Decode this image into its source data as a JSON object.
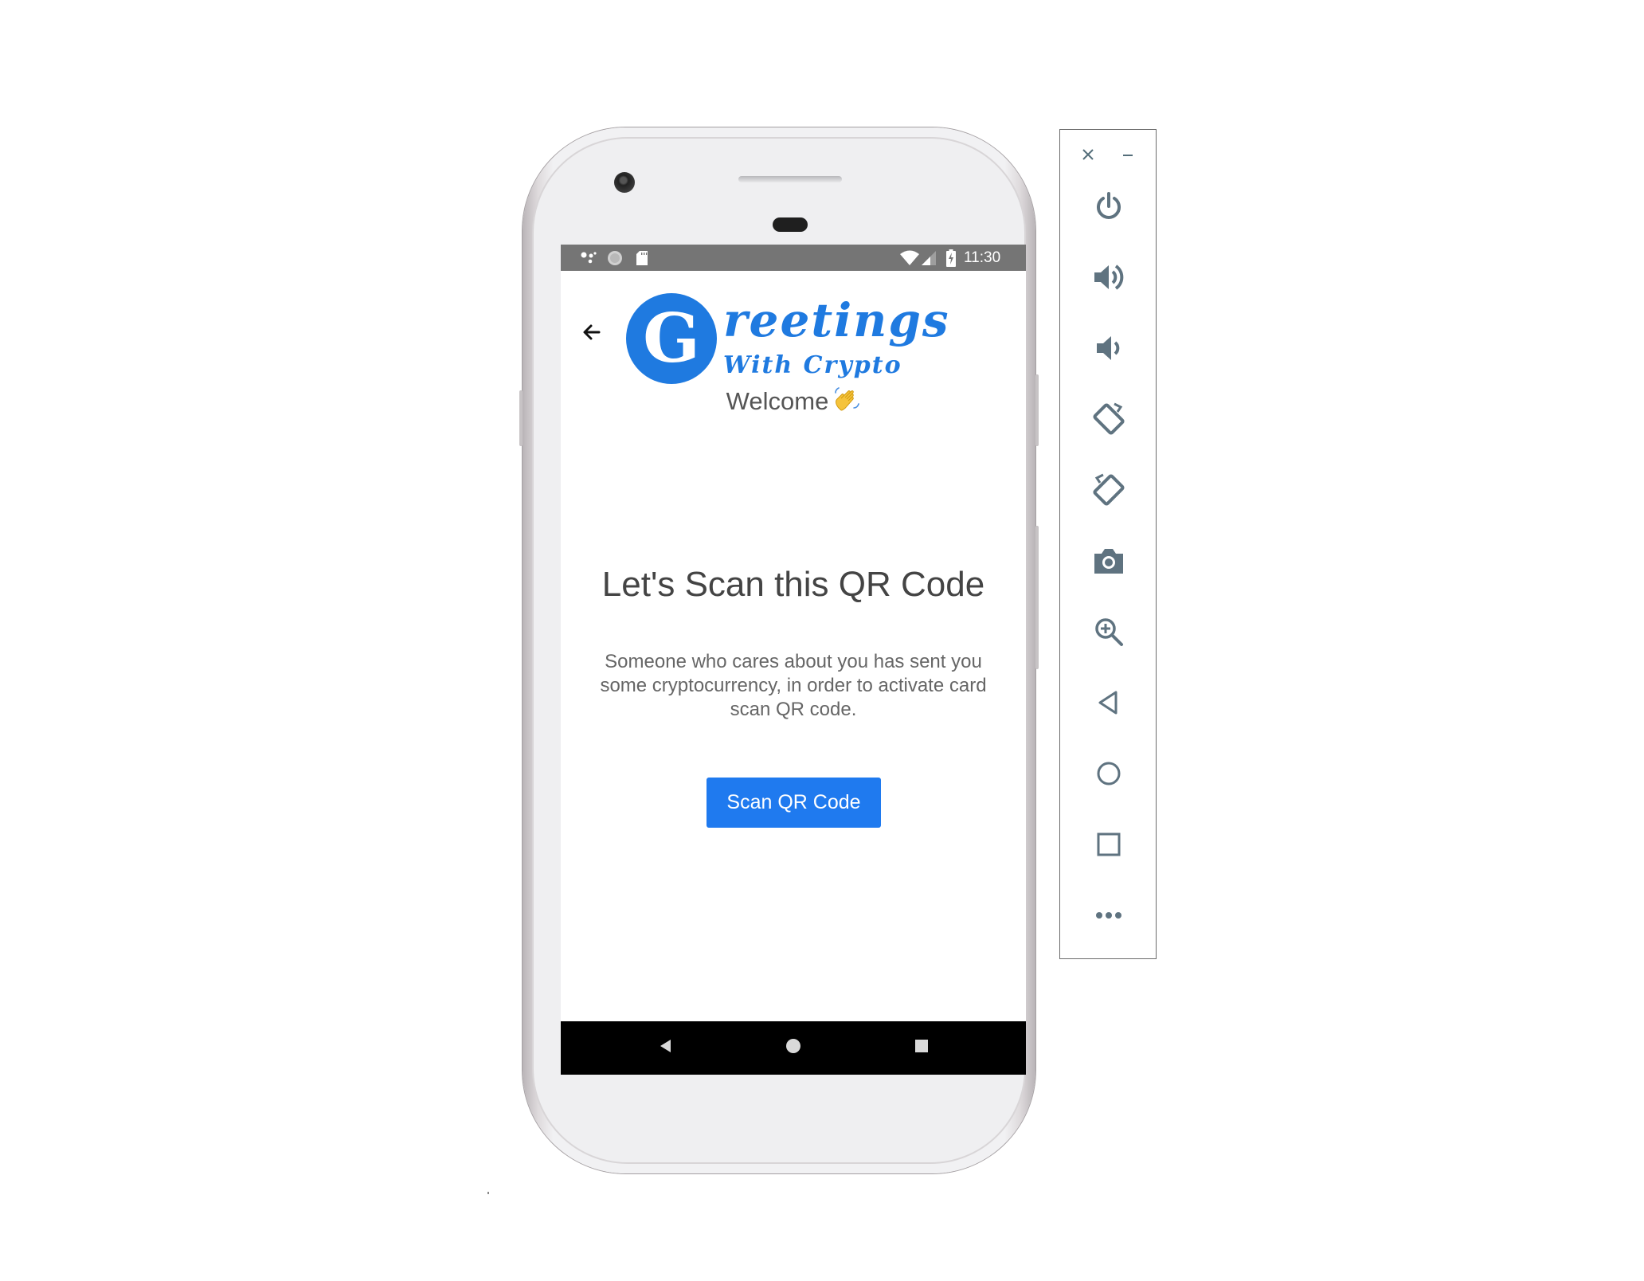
{
  "status_bar": {
    "time": "11:30",
    "left_icons": [
      "assistant-icon",
      "circle-icon",
      "sd-card-icon"
    ],
    "right_icons": [
      "wifi-icon",
      "signal-icon",
      "battery-charging-icon"
    ]
  },
  "app": {
    "logo": {
      "initial": "G",
      "top_text": "reetings",
      "bottom_text": "With Crypto",
      "color": "#1f7ae0"
    },
    "welcome": "Welcome",
    "title": "Let's Scan this QR Code",
    "description": "Someone who cares about you has sent you some cryptocurrency, in order to activate card scan QR code.",
    "scan_button_label": "Scan QR Code",
    "accent_color": "#1f7aef"
  },
  "nav_bar": {
    "buttons": [
      "back-icon",
      "home-icon",
      "recents-icon"
    ]
  },
  "emulator_toolbar": {
    "window_controls": [
      "close-icon",
      "minimize-icon"
    ],
    "buttons": [
      "power-icon",
      "volume-up-icon",
      "volume-down-icon",
      "rotate-left-icon",
      "rotate-right-icon",
      "camera-icon",
      "zoom-icon",
      "back-icon",
      "home-icon",
      "overview-icon",
      "more-icon"
    ]
  }
}
